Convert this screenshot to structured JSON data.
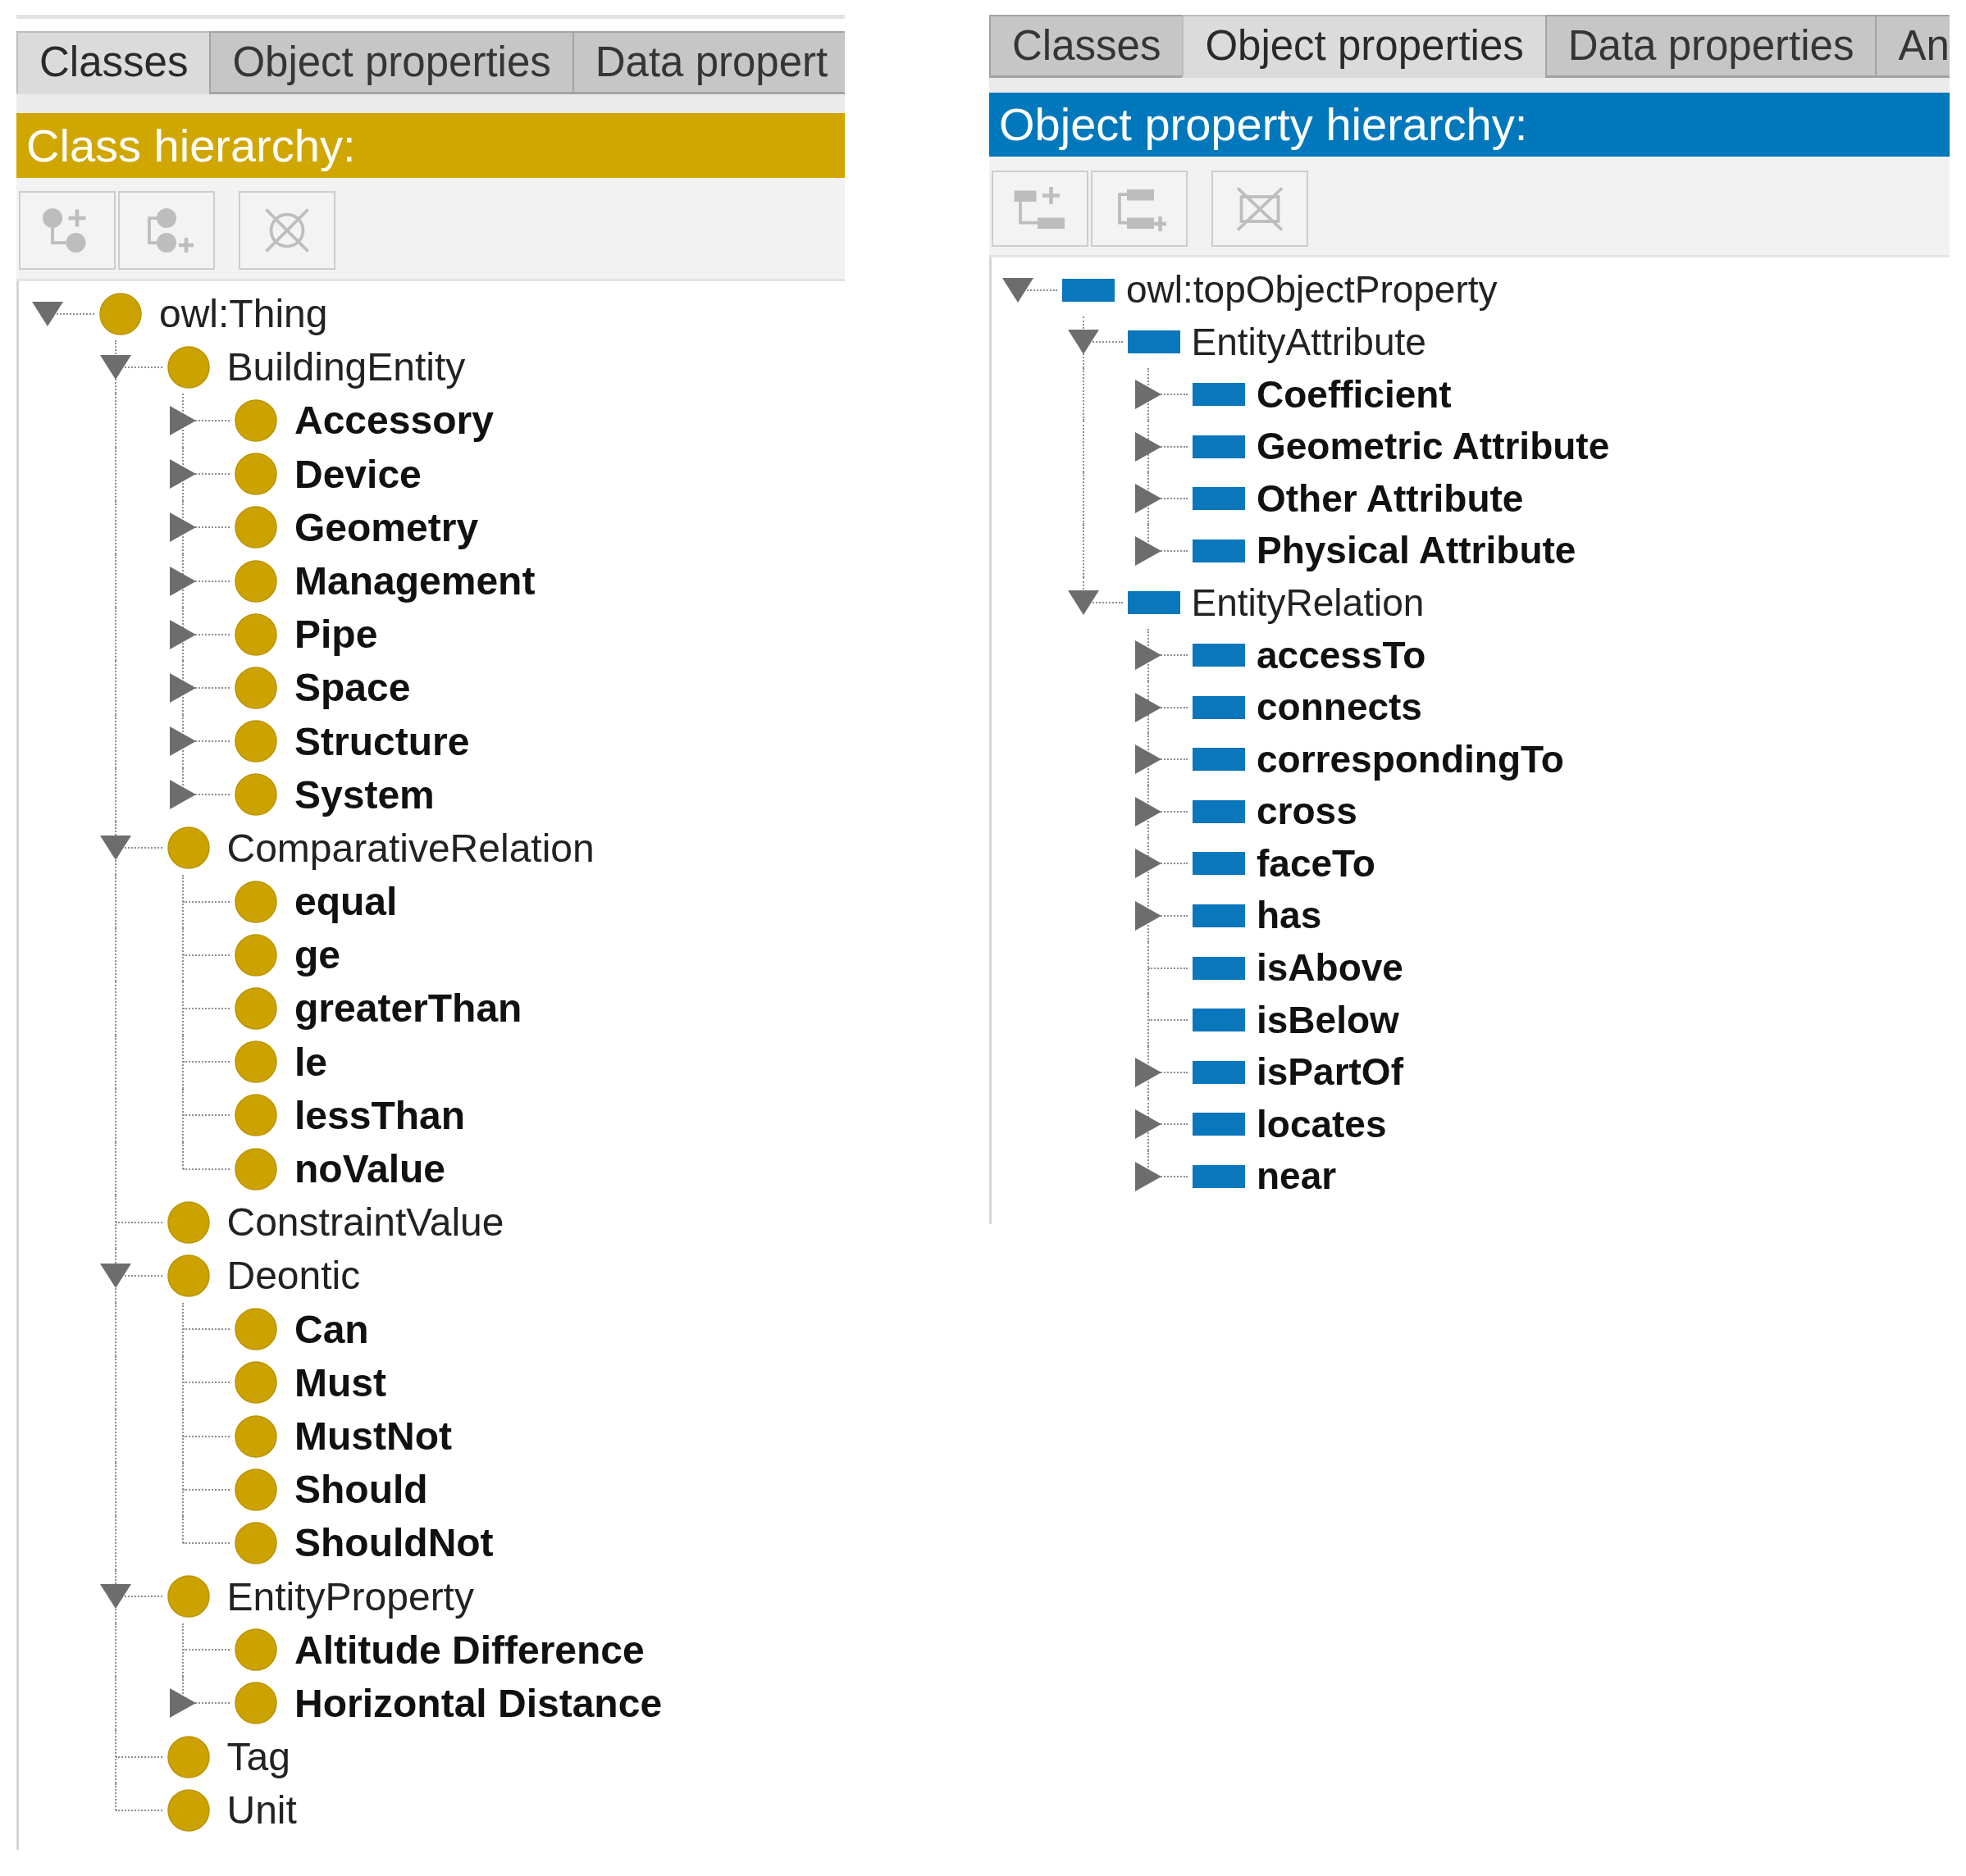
{
  "panels": [
    {
      "kind": "class",
      "tabs": [
        {
          "label": "Classes",
          "selected": true
        },
        {
          "label": "Object properties",
          "selected": false
        },
        {
          "label": "Data propert",
          "selected": false
        }
      ],
      "header": "Class hierarchy:",
      "toolbar": [
        {
          "kind": "add_child",
          "disabled": true
        },
        {
          "kind": "add_sibling",
          "disabled": true
        },
        {
          "kind": "delete",
          "disabled": true
        }
      ],
      "tree": [
        {
          "label": "owl:Thing",
          "expanded": true,
          "emphasized": false,
          "children": [
            {
              "label": "BuildingEntity",
              "expanded": true,
              "emphasized": false,
              "children": [
                {
                  "label": "Accessory",
                  "expanded": false,
                  "emphasized": true
                },
                {
                  "label": "Device",
                  "expanded": false,
                  "emphasized": true
                },
                {
                  "label": "Geometry",
                  "expanded": false,
                  "emphasized": true
                },
                {
                  "label": "Management",
                  "expanded": false,
                  "emphasized": true
                },
                {
                  "label": "Pipe",
                  "expanded": false,
                  "emphasized": true
                },
                {
                  "label": "Space",
                  "expanded": false,
                  "emphasized": true
                },
                {
                  "label": "Structure",
                  "expanded": false,
                  "emphasized": true
                },
                {
                  "label": "System",
                  "expanded": false,
                  "emphasized": true
                }
              ]
            },
            {
              "label": "ComparativeRelation",
              "expanded": true,
              "emphasized": false,
              "children": [
                {
                  "label": "equal",
                  "emphasized": true
                },
                {
                  "label": "ge",
                  "emphasized": true
                },
                {
                  "label": "greaterThan",
                  "emphasized": true
                },
                {
                  "label": "le",
                  "emphasized": true
                },
                {
                  "label": "lessThan",
                  "emphasized": true
                },
                {
                  "label": "noValue",
                  "emphasized": true
                }
              ]
            },
            {
              "label": "ConstraintValue",
              "emphasized": false
            },
            {
              "label": "Deontic",
              "expanded": true,
              "emphasized": false,
              "children": [
                {
                  "label": "Can",
                  "emphasized": true
                },
                {
                  "label": "Must",
                  "emphasized": true
                },
                {
                  "label": "MustNot",
                  "emphasized": true
                },
                {
                  "label": "Should",
                  "emphasized": true
                },
                {
                  "label": "ShouldNot",
                  "emphasized": true
                }
              ]
            },
            {
              "label": "EntityProperty",
              "expanded": true,
              "emphasized": false,
              "children": [
                {
                  "label": "Altitude Difference",
                  "emphasized": true
                },
                {
                  "label": "Horizontal Distance",
                  "expanded": false,
                  "emphasized": true
                }
              ]
            },
            {
              "label": "Tag",
              "emphasized": false
            },
            {
              "label": "Unit",
              "emphasized": false
            }
          ]
        }
      ]
    },
    {
      "kind": "object_property",
      "tabs": [
        {
          "label": "Classes",
          "selected": false
        },
        {
          "label": "Object properties",
          "selected": true
        },
        {
          "label": "Data properties",
          "selected": false
        },
        {
          "label": "An",
          "selected": false
        }
      ],
      "header": "Object property hierarchy:",
      "toolbar": [
        {
          "kind": "add_child",
          "disabled": true
        },
        {
          "kind": "add_sibling",
          "disabled": true
        },
        {
          "kind": "delete",
          "disabled": true
        }
      ],
      "tree": [
        {
          "label": "owl:topObjectProperty",
          "expanded": true,
          "emphasized": false,
          "children": [
            {
              "label": "EntityAttribute",
              "expanded": true,
              "emphasized": false,
              "children": [
                {
                  "label": "Coefficient",
                  "expanded": false,
                  "emphasized": true
                },
                {
                  "label": "Geometric Attribute",
                  "expanded": false,
                  "emphasized": true
                },
                {
                  "label": "Other Attribute",
                  "expanded": false,
                  "emphasized": true
                },
                {
                  "label": "Physical Attribute",
                  "expanded": false,
                  "emphasized": true
                }
              ]
            },
            {
              "label": "EntityRelation",
              "expanded": true,
              "emphasized": false,
              "children": [
                {
                  "label": "accessTo",
                  "expanded": false,
                  "emphasized": true
                },
                {
                  "label": "connects",
                  "expanded": false,
                  "emphasized": true
                },
                {
                  "label": "correspondingTo",
                  "expanded": false,
                  "emphasized": true
                },
                {
                  "label": "cross",
                  "expanded": false,
                  "emphasized": true
                },
                {
                  "label": "faceTo",
                  "expanded": false,
                  "emphasized": true
                },
                {
                  "label": "has",
                  "expanded": false,
                  "emphasized": true
                },
                {
                  "label": "isAbove",
                  "emphasized": true
                },
                {
                  "label": "isBelow",
                  "emphasized": true
                },
                {
                  "label": "isPartOf",
                  "expanded": false,
                  "emphasized": true
                },
                {
                  "label": "locates",
                  "expanded": false,
                  "emphasized": true
                },
                {
                  "label": "near",
                  "expanded": false,
                  "emphasized": true
                }
              ]
            }
          ]
        }
      ]
    }
  ]
}
